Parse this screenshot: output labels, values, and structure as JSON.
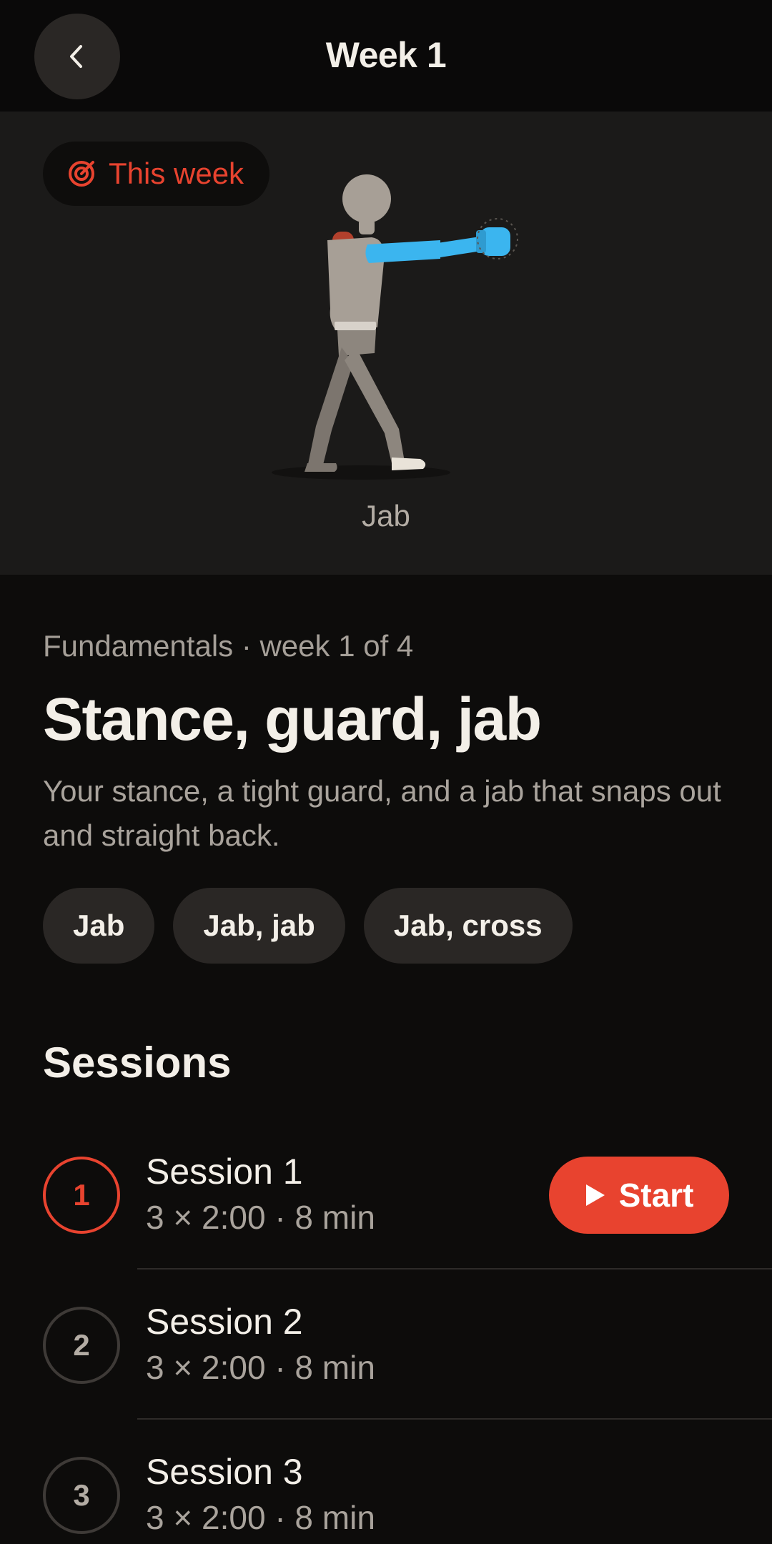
{
  "header": {
    "title": "Week 1",
    "back_icon": "chevron-left-icon"
  },
  "hero": {
    "badge_label": "This week",
    "badge_icon": "target-icon",
    "caption": "Jab",
    "highlight_color": "#3bb5ef"
  },
  "program": {
    "meta": "Fundamentals · week 1 of 4",
    "title": "Stance, guard, jab",
    "description": "Your stance, a tight guard, and a jab that snaps out and straight back."
  },
  "chips": [
    "Jab",
    "Jab, jab",
    "Jab, cross"
  ],
  "sessions_title": "Sessions",
  "sessions": [
    {
      "number": "1",
      "name": "Session 1",
      "detail": "3 × 2:00 · 8 min",
      "action_label": "Start"
    },
    {
      "number": "2",
      "name": "Session 2",
      "detail": "3 × 2:00 · 8 min"
    },
    {
      "number": "3",
      "name": "Session 3",
      "detail": "3 × 2:00 · 8 min"
    }
  ],
  "colors": {
    "accent": "#e8432f",
    "background": "#0d0c0b",
    "surface": "#2a2725"
  }
}
